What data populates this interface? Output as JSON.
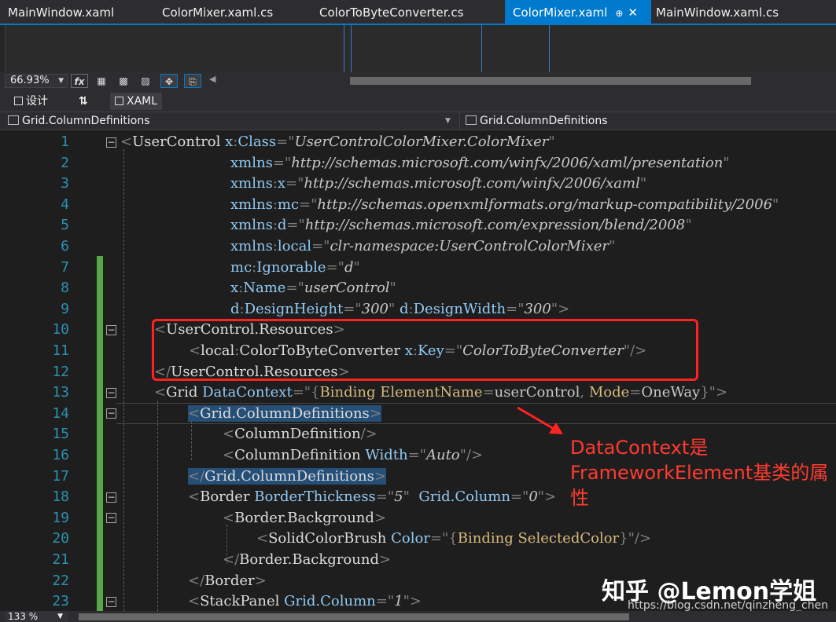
{
  "tabs": [
    {
      "label": "MainWindow.xaml"
    },
    {
      "label": "ColorMixer.xaml.cs"
    },
    {
      "label": "ColorToByteConverter.cs"
    },
    {
      "label": "ColorMixer.xaml",
      "pin": "⊕",
      "close": "✕"
    },
    {
      "label": "MainWindow.xaml.cs"
    }
  ],
  "toolbar": {
    "zoom": "66.93%",
    "fx": "fx"
  },
  "split": {
    "design_label": "设计",
    "swap": "⇅",
    "xaml_label": "XAML"
  },
  "nav": {
    "left": "Grid.ColumnDefinitions",
    "right": "Grid.ColumnDefinitions"
  },
  "line_numbers": [
    "1",
    "2",
    "3",
    "4",
    "5",
    "6",
    "7",
    "8",
    "9",
    "10",
    "11",
    "12",
    "13",
    "14",
    "15",
    "16",
    "17",
    "18",
    "19",
    "20",
    "21",
    "22",
    "23"
  ],
  "code": {
    "l1": [
      "<",
      "UserControl",
      " x",
      ":",
      "Class",
      "=\"",
      "UserControlColorMixer.ColorMixer",
      "\""
    ],
    "l2_attr": "xmlns",
    "l2_val": "http://schemas.microsoft.com/winfx/2006/xaml/presentation",
    "l3_attr": "xmlns",
    "l3_pf": "x",
    "l3_val": "http://schemas.microsoft.com/winfx/2006/xaml",
    "l4_attr": "xmlns",
    "l4_pf": "mc",
    "l4_val": "http://schemas.openxmlformats.org/markup-compatibility/2006",
    "l5_attr": "xmlns",
    "l5_pf": "d",
    "l5_val": "http://schemas.microsoft.com/expression/blend/2008",
    "l6_attr": "xmlns",
    "l6_pf": "local",
    "l6_val": "clr-namespace:UserControlColorMixer",
    "l7_pf": "mc",
    "l7_attr": "Ignorable",
    "l7_val": "d",
    "l8_pf": "x",
    "l8_attr": "Name",
    "l8_val": "userControl",
    "l9_pf1": "d",
    "l9_attr1": "DesignHeight",
    "l9_val1": "300",
    "l9_pf2": "d",
    "l9_attr2": "DesignWidth",
    "l9_val2": "300",
    "l10": "UserControl.Resources",
    "l11_pf": "local",
    "l11_el": "ColorToByteConverter",
    "l11_apf": "x",
    "l11_attr": "Key",
    "l11_val": "ColorToByteConverter",
    "l12": "UserControl.Resources",
    "l13_el": "Grid",
    "l13_attr": "DataContext",
    "l13_b1": "Binding",
    "l13_a2": "ElementName",
    "l13_v2": "userControl",
    "l13_a3": "Mode",
    "l13_v3": "OneWay",
    "l14": "Grid.ColumnDefinitions",
    "l15": "ColumnDefinition",
    "l16_el": "ColumnDefinition",
    "l16_attr": "Width",
    "l16_val": "Auto",
    "l17": "Grid.ColumnDefinitions",
    "l18_el": "Border",
    "l18_attr1": "BorderThickness",
    "l18_val1": "5",
    "l18_attr2": "Grid.Column",
    "l18_val2": "0",
    "l19": "Border.Background",
    "l20_el": "SolidColorBrush",
    "l20_attr": "Color",
    "l20_b": "Binding",
    "l20_v": "SelectedColor",
    "l21": "Border.Background",
    "l22": "Border",
    "l23_el": "StackPanel",
    "l23_attr": "Grid.Column",
    "l23_val": "1"
  },
  "annotation": {
    "line1": "DataContext是",
    "line2": "FrameworkElement基类的属",
    "line3": "性"
  },
  "watermark": "知乎 @Lemon学姐",
  "url": "https://blog.csdn.net/qinzheng_chen",
  "status": {
    "zoom": "133 %"
  },
  "colors": {
    "accent": "#007acc",
    "annotation": "#ff2222",
    "changebar": "#57a64a"
  }
}
